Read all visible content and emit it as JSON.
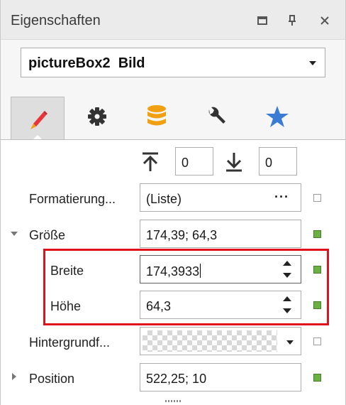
{
  "window": {
    "title": "Eigenschaften"
  },
  "object_selector": {
    "value": "pictureBox2  Bild"
  },
  "tabs": [
    {
      "icon": "brush-icon",
      "active": true
    },
    {
      "icon": "gear-icon",
      "active": false
    },
    {
      "icon": "database-icon",
      "active": false
    },
    {
      "icon": "wrench-icon",
      "active": false
    },
    {
      "icon": "star-icon",
      "active": false
    }
  ],
  "sort": {
    "top_value": "0",
    "bottom_value": "0"
  },
  "properties": {
    "formatierung": {
      "label": "Formatierung...",
      "value": "(Liste)",
      "button": "···"
    },
    "groesse": {
      "label": "Größe",
      "value": "174,39; 64,3"
    },
    "breite": {
      "label": "Breite",
      "value": "174,3933"
    },
    "hoehe": {
      "label": "Höhe",
      "value": "64,3"
    },
    "hintergrund": {
      "label": "Hintergrundf..."
    },
    "position": {
      "label": "Position",
      "value": "522,25; 10"
    }
  },
  "colors": {
    "accent_blue": "#3a7bd5",
    "database_orange": "#f0a010",
    "brush_red": "#e8343a",
    "set_marker": "#6ab043",
    "highlight": "#e0111b"
  }
}
